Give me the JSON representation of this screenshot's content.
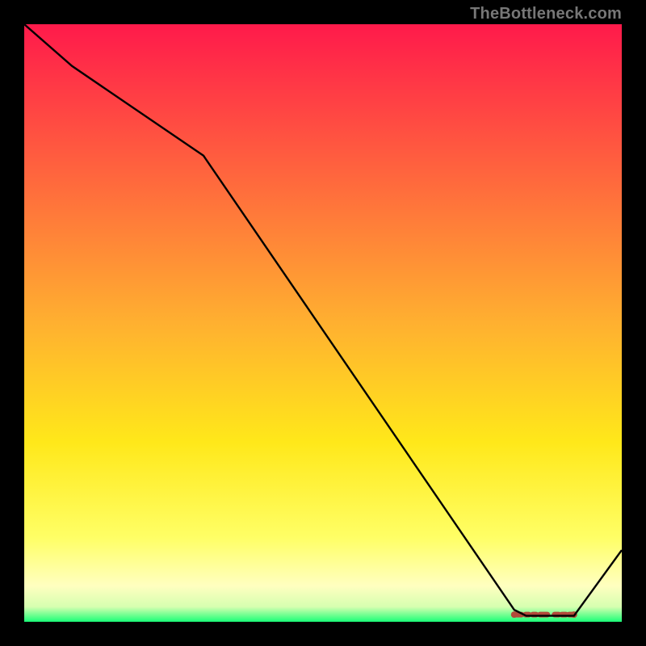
{
  "watermark": "TheBottleneck.com",
  "chart_data": {
    "type": "line",
    "title": "",
    "xlabel": "",
    "ylabel": "",
    "xlim": [
      0,
      100
    ],
    "ylim": [
      0,
      100
    ],
    "x": [
      0,
      8,
      30,
      82,
      84,
      90,
      92,
      100
    ],
    "values": [
      100,
      93,
      78,
      2,
      1,
      1,
      1,
      12
    ],
    "optimum_band": {
      "x_start": 82,
      "x_end": 92,
      "y": 1.2,
      "color": "#b24a3a"
    },
    "gradient_stops": [
      {
        "pct": 0.0,
        "color": "#ff1a4b"
      },
      {
        "pct": 50.0,
        "color": "#ffb030"
      },
      {
        "pct": 70.0,
        "color": "#ffe81a"
      },
      {
        "pct": 86.0,
        "color": "#ffff66"
      },
      {
        "pct": 94.0,
        "color": "#ffffc0"
      },
      {
        "pct": 97.5,
        "color": "#d6ffb0"
      },
      {
        "pct": 100.0,
        "color": "#1bff77"
      }
    ]
  }
}
